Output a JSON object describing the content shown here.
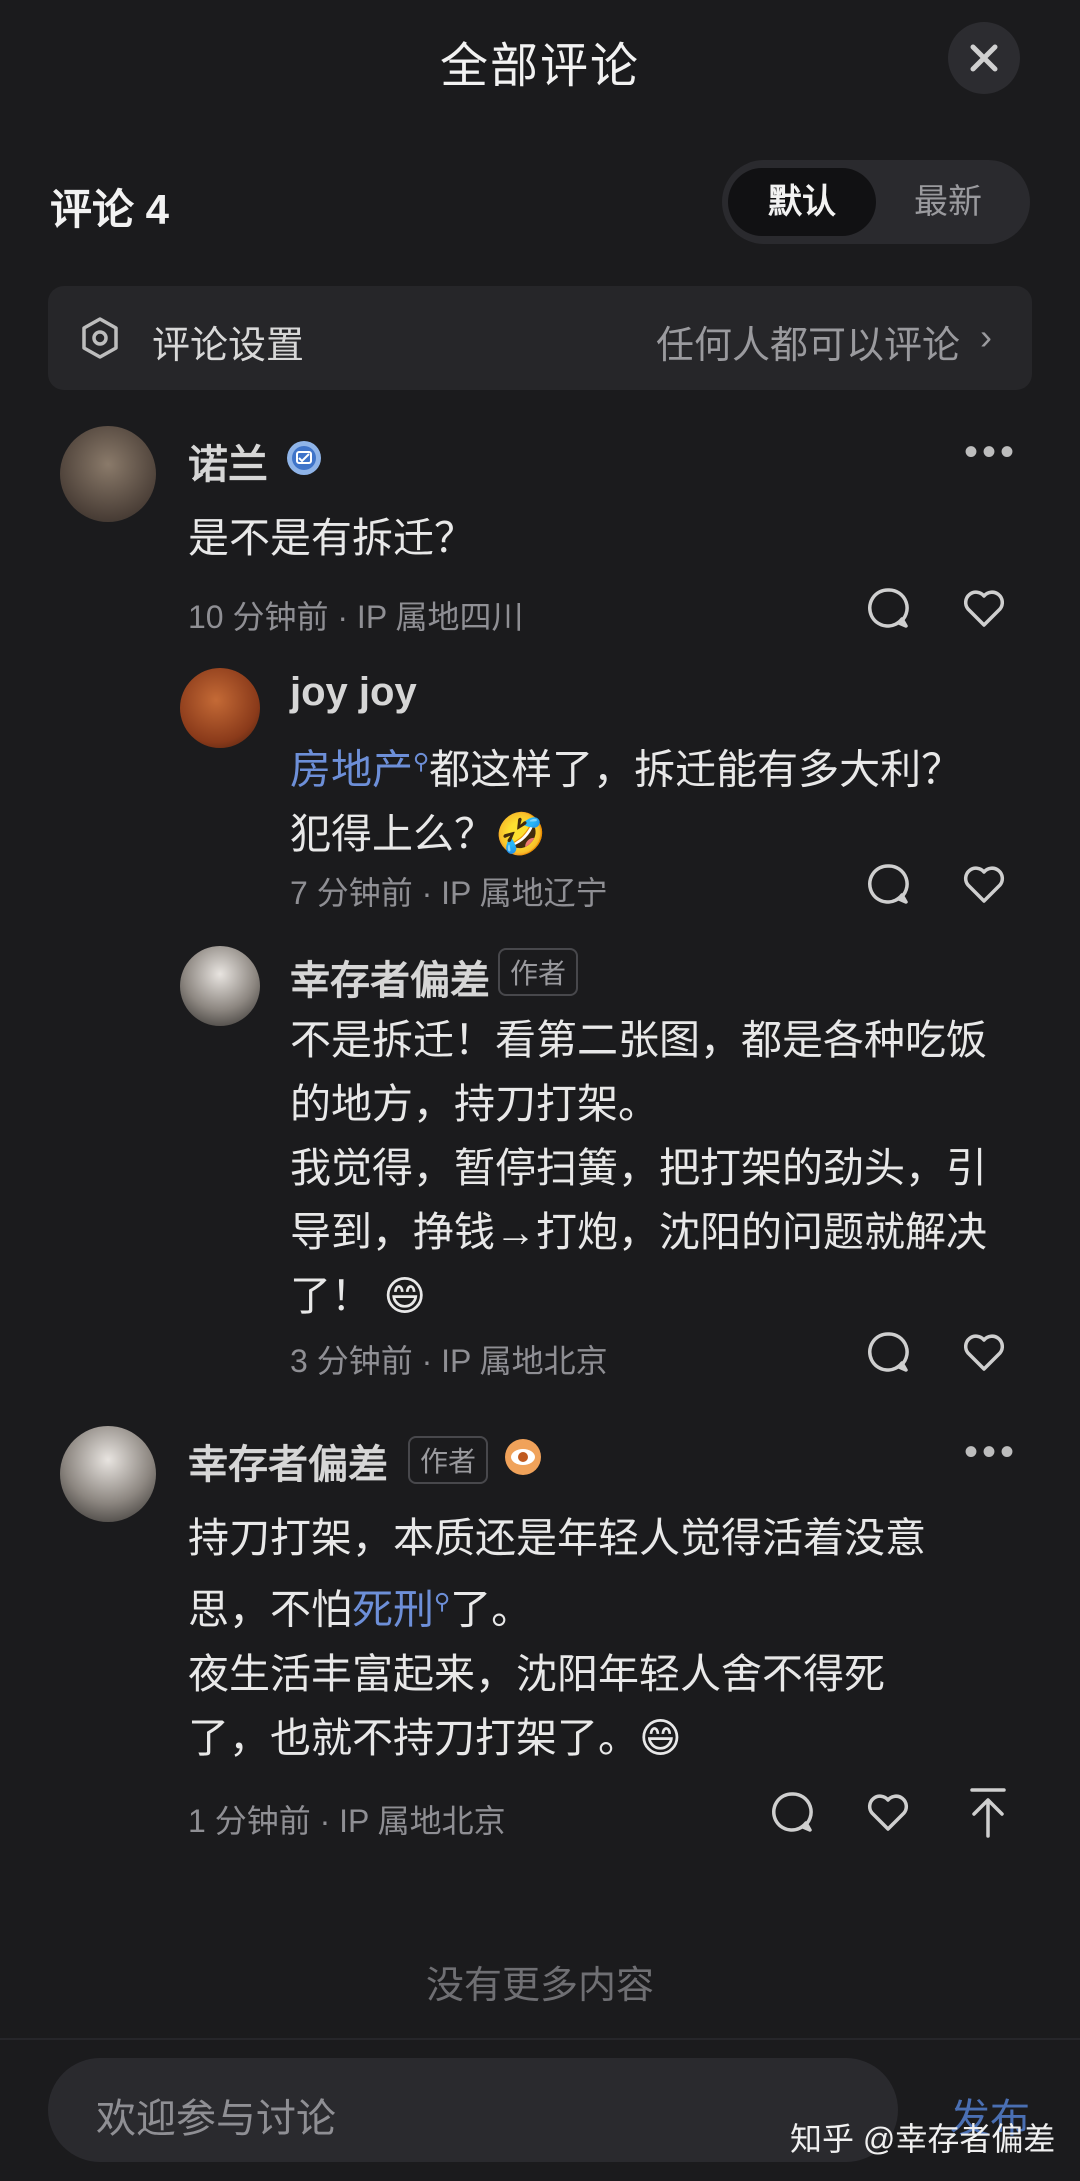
{
  "header": {
    "title": "全部评论",
    "close_icon": "close-icon"
  },
  "toolbar": {
    "count_label": "评论 4",
    "sort": [
      "默认",
      "最新"
    ],
    "sort_active": "默认"
  },
  "settings": {
    "label": "评论设置",
    "value": "任何人都可以评论",
    "chevron": "›"
  },
  "comments": [
    {
      "user": "诺兰",
      "text": "是不是有拆迁？",
      "meta": "10 分钟前 · IP 属地四川",
      "replies": [
        {
          "user": "joy joy",
          "link": "房地产",
          "text_after_link": "都这样了，拆迁能有多大利？",
          "text_line2": "犯得上么？",
          "emoji": "🤣",
          "meta": "7 分钟前 · IP 属地辽宁"
        },
        {
          "user": "幸存者偏差",
          "badge": "作者",
          "lines": [
            "不是拆迁！看第二张图，都是各种吃饭",
            "的地方，持刀打架。",
            "我觉得，暂停扫簧，把打架的劲头，引",
            "导到，挣钱→打炮，沈阳的问题就解决",
            "了！"
          ],
          "emoji": "😄",
          "meta": "3 分钟前 · IP 属地北京"
        }
      ]
    },
    {
      "user": "幸存者偏差",
      "badge": "作者",
      "line1": "持刀打架，本质还是年轻人觉得活着没意",
      "line2_before": "思，不怕",
      "link": "死刑",
      "line2_after": "了。",
      "line3": "夜生活丰富起来，沈阳年轻人舍不得死",
      "line4": "了，也就不持刀打架了。",
      "emoji": "😄",
      "meta": "1 分钟前 · IP 属地北京"
    }
  ],
  "footer": {
    "no_more": "没有更多内容",
    "input_placeholder": "欢迎参与讨论",
    "send_label": "发布",
    "watermark": "知乎 @幸存者偏差"
  },
  "colors": {
    "background": "#1b1b1d",
    "link": "#6d8fd8",
    "muted": "#8f8f94"
  }
}
